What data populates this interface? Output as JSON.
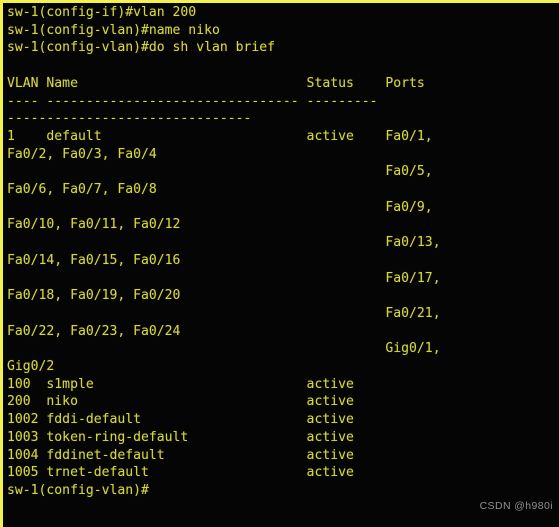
{
  "terminal": {
    "device_hostname": "sw-1",
    "colors": {
      "background": "#050505",
      "foreground": "#d6d63f",
      "border": "#f2f24a",
      "watermark": "#8e8e8e"
    },
    "command_history": [
      "sw-1(config-if)#vlan 200",
      "sw-1(config-vlan)#name niko",
      "sw-1(config-vlan)#do sh vlan brief"
    ],
    "table": {
      "headers": [
        "VLAN",
        "Name",
        "Status",
        "Ports"
      ],
      "header_line": "VLAN Name                             Status    Ports",
      "separator_line_1": "---- -------------------------------- ---------",
      "separator_line_2": "-------------------------------",
      "rows": [
        {
          "vlan": "1",
          "name": "default",
          "status": "active",
          "ports": [
            "Fa0/1",
            "Fa0/2",
            "Fa0/3",
            "Fa0/4",
            "Fa0/5",
            "Fa0/6",
            "Fa0/7",
            "Fa0/8",
            "Fa0/9",
            "Fa0/10",
            "Fa0/11",
            "Fa0/12",
            "Fa0/13",
            "Fa0/14",
            "Fa0/15",
            "Fa0/16",
            "Fa0/17",
            "Fa0/18",
            "Fa0/19",
            "Fa0/20",
            "Fa0/21",
            "Fa0/22",
            "Fa0/23",
            "Fa0/24",
            "Gig0/1",
            "Gig0/2"
          ]
        },
        {
          "vlan": "100",
          "name": "s1mple",
          "status": "active",
          "ports": []
        },
        {
          "vlan": "200",
          "name": "niko",
          "status": "active",
          "ports": []
        },
        {
          "vlan": "1002",
          "name": "fddi-default",
          "status": "active",
          "ports": []
        },
        {
          "vlan": "1003",
          "name": "token-ring-default",
          "status": "active",
          "ports": []
        },
        {
          "vlan": "1004",
          "name": "fddinet-default",
          "status": "active",
          "ports": []
        },
        {
          "vlan": "1005",
          "name": "trnet-default",
          "status": "active",
          "ports": []
        }
      ]
    },
    "prompt": "sw-1(config-vlan)#",
    "raw_screen": "sw-1(config-if)#vlan 200\nsw-1(config-vlan)#name niko\nsw-1(config-vlan)#do sh vlan brief\n\nVLAN Name                             Status    Ports\n---- -------------------------------- ---------\n-------------------------------\n1    default                          active    Fa0/1,\nFa0/2, Fa0/3, Fa0/4\n                                                Fa0/5,\nFa0/6, Fa0/7, Fa0/8\n                                                Fa0/9,\nFa0/10, Fa0/11, Fa0/12\n                                                Fa0/13,\nFa0/14, Fa0/15, Fa0/16\n                                                Fa0/17,\nFa0/18, Fa0/19, Fa0/20\n                                                Fa0/21,\nFa0/22, Fa0/23, Fa0/24\n                                                Gig0/1,\nGig0/2\n100  s1mple                           active\n200  niko                             active\n1002 fddi-default                     active\n1003 token-ring-default               active\n1004 fddinet-default                  active\n1005 trnet-default                    active\nsw-1(config-vlan)#"
  },
  "watermark": {
    "text": "CSDN @h980i"
  }
}
